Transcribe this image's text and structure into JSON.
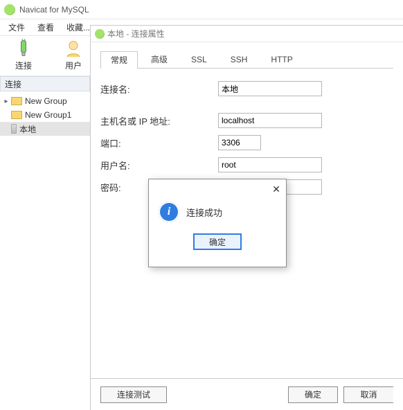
{
  "app": {
    "title": "Navicat for MySQL"
  },
  "menu": {
    "file": "文件",
    "view": "查看",
    "favorites": "收藏..."
  },
  "toolbar": {
    "connect_label": "连接",
    "user_label": "用户"
  },
  "sidebar": {
    "header": "连接",
    "items": [
      {
        "label": "New Group"
      },
      {
        "label": "New Group1"
      },
      {
        "label": "本地"
      }
    ]
  },
  "dialog": {
    "title": "本地 - 连接属性",
    "tabs": {
      "general": "常规",
      "advanced": "高级",
      "ssl": "SSL",
      "ssh": "SSH",
      "http": "HTTP"
    },
    "labels": {
      "name": "连接名:",
      "host": "主机名或 IP 地址:",
      "port": "端口:",
      "user": "用户名:",
      "password": "密码:"
    },
    "values": {
      "name": "本地",
      "host": "localhost",
      "port": "3306",
      "user": "root",
      "password": "●●●●"
    },
    "buttons": {
      "test": "连接测试",
      "ok": "确定",
      "cancel": "取消"
    }
  },
  "msgbox": {
    "text": "连接成功",
    "ok": "确定"
  }
}
